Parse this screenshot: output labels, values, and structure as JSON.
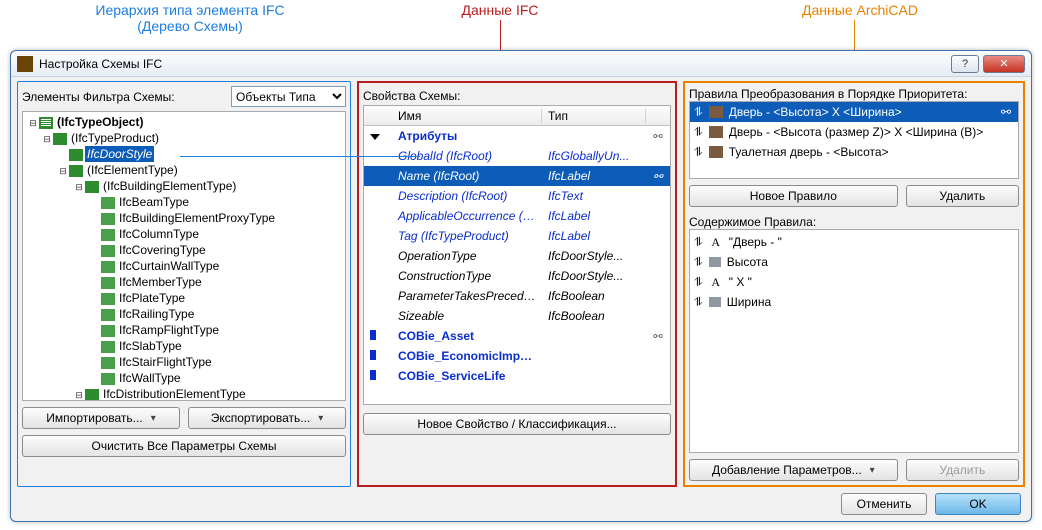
{
  "annotations": {
    "hierarchy_top": "Иерархия типа элемента  IFC",
    "hierarchy_sub": "(Дерево Схемы)",
    "ifc_data": "Данные IFC",
    "archicad_data": "Данные ArchiCAD"
  },
  "window": {
    "title": "Настройка Схемы IFC"
  },
  "left": {
    "filter_label": "Элементы Фильтра Схемы:",
    "filter_value": "Объекты Типа",
    "import": "Импортировать...",
    "export": "Экспортировать...",
    "clear": "Очистить Все Параметры Схемы",
    "tree": [
      {
        "lvl": 0,
        "kind": "schema",
        "twist": "▢−",
        "bold": true,
        "text": "(IfcTypeObject)"
      },
      {
        "lvl": 1,
        "kind": "folder",
        "twist": "▢−",
        "bold": false,
        "text": "(IfcTypeProduct)"
      },
      {
        "lvl": 2,
        "kind": "sel",
        "twist": "",
        "bold": false,
        "text": "IfcDoorStyle",
        "selected": true
      },
      {
        "lvl": 2,
        "kind": "folder",
        "twist": "▢−",
        "bold": false,
        "text": "(IfcElementType)"
      },
      {
        "lvl": 3,
        "kind": "folder",
        "twist": "▢−",
        "bold": false,
        "text": "(IfcBuildingElementType)"
      },
      {
        "lvl": 4,
        "kind": "item",
        "twist": "",
        "bold": false,
        "text": "IfcBeamType"
      },
      {
        "lvl": 4,
        "kind": "item",
        "twist": "",
        "bold": false,
        "text": "IfcBuildingElementProxyType"
      },
      {
        "lvl": 4,
        "kind": "item",
        "twist": "",
        "bold": false,
        "text": "IfcColumnType"
      },
      {
        "lvl": 4,
        "kind": "item",
        "twist": "",
        "bold": false,
        "text": "IfcCoveringType"
      },
      {
        "lvl": 4,
        "kind": "item",
        "twist": "",
        "bold": false,
        "text": "IfcCurtainWallType"
      },
      {
        "lvl": 4,
        "kind": "item",
        "twist": "",
        "bold": false,
        "text": "IfcMemberType"
      },
      {
        "lvl": 4,
        "kind": "item",
        "twist": "",
        "bold": false,
        "text": "IfcPlateType"
      },
      {
        "lvl": 4,
        "kind": "item",
        "twist": "",
        "bold": false,
        "text": "IfcRailingType"
      },
      {
        "lvl": 4,
        "kind": "item",
        "twist": "",
        "bold": false,
        "text": "IfcRampFlightType"
      },
      {
        "lvl": 4,
        "kind": "item",
        "twist": "",
        "bold": false,
        "text": "IfcSlabType"
      },
      {
        "lvl": 4,
        "kind": "item",
        "twist": "",
        "bold": false,
        "text": "IfcStairFlightType"
      },
      {
        "lvl": 4,
        "kind": "item",
        "twist": "",
        "bold": false,
        "text": "IfcWallType"
      },
      {
        "lvl": 3,
        "kind": "folder",
        "twist": "▢−",
        "bold": false,
        "text": "IfcDistributionElementType"
      }
    ]
  },
  "mid": {
    "header": "Свойства Схемы:",
    "col_name": "Имя",
    "col_type": "Тип",
    "rows": [
      {
        "kind": "group",
        "exp": "down",
        "name": "Атрибуты",
        "type": "",
        "chain": true
      },
      {
        "kind": "link",
        "name": "GlobalId (IfcRoot)",
        "type": "IfcGloballyUn..."
      },
      {
        "kind": "link",
        "name": "Name (IfcRoot)",
        "type": "IfcLabel",
        "sel": true,
        "chain": true
      },
      {
        "kind": "link",
        "name": "Description (IfcRoot)",
        "type": "IfcText"
      },
      {
        "kind": "link",
        "name": "ApplicableOccurrence (IfcTyp...",
        "type": "IfcLabel"
      },
      {
        "kind": "link",
        "name": "Tag (IfcTypeProduct)",
        "type": "IfcLabel"
      },
      {
        "kind": "plain",
        "name": "OperationType",
        "type": "IfcDoorStyle..."
      },
      {
        "kind": "plain",
        "name": "ConstructionType",
        "type": "IfcDoorStyle..."
      },
      {
        "kind": "plain",
        "name": "ParameterTakesPrecedence",
        "type": "IfcBoolean"
      },
      {
        "kind": "plain",
        "name": "Sizeable",
        "type": "IfcBoolean"
      },
      {
        "kind": "group",
        "exp": "right",
        "name": "COBie_Asset",
        "type": "",
        "chain": true
      },
      {
        "kind": "group",
        "exp": "right",
        "name": "COBie_EconomicImpactVa...",
        "type": ""
      },
      {
        "kind": "group",
        "exp": "right",
        "name": "COBie_ServiceLife",
        "type": ""
      }
    ],
    "new_prop": "Новое Свойство / Классификация..."
  },
  "right": {
    "header": "Правила Преобразования в Порядке Приоритета:",
    "rules": [
      {
        "text": "Дверь - <Высота> X <Ширина>",
        "sel": true,
        "chain": true
      },
      {
        "text": "Дверь - <Высота (размер Z)> X <Ширина (В)>"
      },
      {
        "text": "Туалетная дверь - <Высота>"
      }
    ],
    "new_rule": "Новое Правило",
    "delete": "Удалить",
    "content_header": "Содержимое Правила:",
    "content": [
      {
        "icon": "A",
        "text": "\"Дверь - \""
      },
      {
        "icon": "block",
        "text": "Высота"
      },
      {
        "icon": "A",
        "text": "\" X \""
      },
      {
        "icon": "block",
        "text": "Ширина"
      }
    ],
    "add_params": "Добавление Параметров...",
    "delete2": "Удалить"
  },
  "footer": {
    "cancel": "Отменить",
    "ok": "OK"
  }
}
